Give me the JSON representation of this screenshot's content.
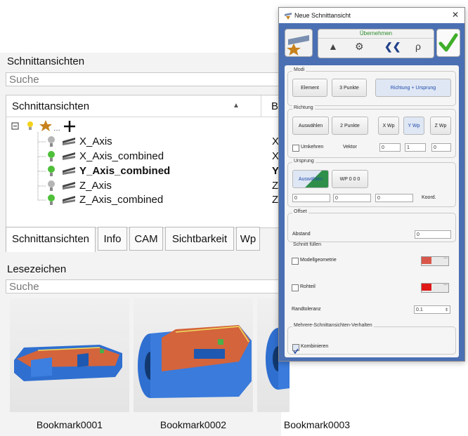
{
  "left_panel": {
    "section_views_title": "Schnittansichten",
    "search_placeholder": "Suche",
    "tree_header": "Schnittansichten",
    "tree_header_col2": "B",
    "tree_items": [
      {
        "label": "X_Axis",
        "col2": "X",
        "visible": false,
        "bold": false
      },
      {
        "label": "X_Axis_combined",
        "col2": "X",
        "visible": true,
        "bold": false
      },
      {
        "label": "Y_Axis_combined",
        "col2": "Y",
        "visible": true,
        "bold": true
      },
      {
        "label": "Z_Axis",
        "col2": "Z",
        "visible": false,
        "bold": false
      },
      {
        "label": "Z_Axis_combined",
        "col2": "Z",
        "visible": true,
        "bold": false
      }
    ],
    "tabs": [
      "Schnittansichten",
      "Info",
      "CAM",
      "Sichtbarkeit",
      "Wp"
    ],
    "active_tab": "Schnittansichten",
    "bookmarks_title": "Lesezeichen",
    "bookmarks_search_placeholder": "Suche",
    "bookmarks": [
      "Bookmark0001",
      "Bookmark0002",
      "Bookmark0003"
    ]
  },
  "dialog": {
    "title": "Neue Schnittansicht",
    "close": "✕",
    "apply_label": "Übernehmen",
    "modi": {
      "title": "Modi",
      "buttons": [
        "Element",
        "3 Punkte",
        "Richtung + Ursprung"
      ],
      "selected": "Richtung + Ursprung"
    },
    "richtung": {
      "title": "Richtung",
      "buttons": [
        "Auswählen",
        "2 Punkte",
        "X Wp",
        "Y Wp",
        "Z Wp"
      ],
      "selected": "Y Wp",
      "reverse_label": "Umkehren",
      "vector_label": "Vektor",
      "vector": [
        "0",
        "1",
        "0"
      ]
    },
    "ursprung": {
      "title": "Ursprung",
      "buttons": [
        "Auswählen",
        "WP 0 0 0"
      ],
      "coords": [
        "0",
        "0",
        "0"
      ],
      "coords_label": "Koord."
    },
    "offset": {
      "title": "Offset",
      "distance_label": "Abstand",
      "distance_value": "0"
    },
    "schnitt_fuellen": {
      "title": "Schnitt füllen",
      "model_geometry_label": "Modellgeometrie",
      "model_geometry_color": "#d9574a",
      "rohteil_label": "Rohteil",
      "rohteil_color": "#e01818",
      "tolerance_label": "Randtoleranz",
      "tolerance_value": "0.1"
    },
    "mehrere": {
      "title": "Mehrere-Schnittansichten-Verhalten",
      "combine_label": "Kombinieren",
      "combine_checked": true
    }
  },
  "colors": {
    "dialog_blue": "#4a6fb3",
    "accent_green": "#3fae2a",
    "cut_orange": "#d4643c",
    "part_blue": "#2f6fd0"
  }
}
